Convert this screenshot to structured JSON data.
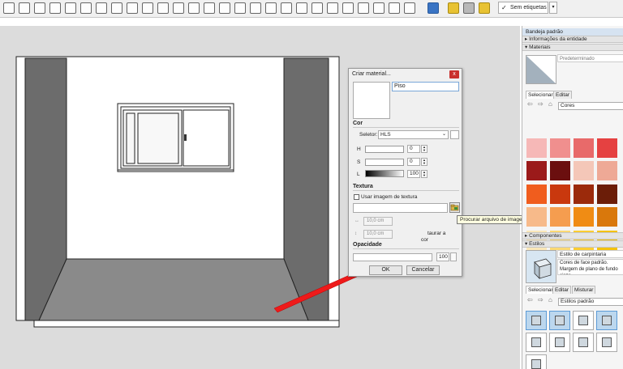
{
  "toolbar": {
    "tag_checkmark": "✓",
    "tag_label": "Sem etiquetas",
    "tag_dropdown_glyph": "▾"
  },
  "dialog": {
    "title": "Criar material...",
    "close_glyph": "x",
    "material_name": "Piso",
    "color_section": "Cor",
    "selector_label": "Seletor:",
    "selector_value": "HLS",
    "channels": [
      {
        "label": "H",
        "value": "0"
      },
      {
        "label": "S",
        "value": "0"
      },
      {
        "label": "L",
        "value": "100"
      }
    ],
    "texture_section": "Textura",
    "use_texture_label": "Usar imagem de textura",
    "width_value": "10,0 cm",
    "height_value": "10,0 cm",
    "restore_text_1": "taurar a",
    "restore_text_2": "cor",
    "opacity_section": "Opacidade",
    "opacity_value": "100",
    "ok_label": "OK",
    "cancel_label": "Cancelar"
  },
  "tooltip": "Procurar arquivo de imagem de material",
  "tray": {
    "title": "Bandeja padrão",
    "entity_info": "Informações da entidade",
    "materials": "Materiais",
    "material_default": "Predeterminado",
    "tab_select": "Selecionar",
    "tab_edit": "Editar",
    "library": "Cores",
    "components": "Componentes",
    "styles": "Estilos",
    "style_name": "Estilo de carpintaria",
    "style_desc": "Cores de face padrão. Margem de plano de fundo cinza.",
    "styles_tab_select": "Selecionar",
    "styles_tab_edit": "Editar",
    "styles_tab_mix": "Misturar",
    "styles_library": "Estilos padrão"
  },
  "swatch_colors": [
    "#f6b8b7",
    "#f08f8e",
    "#e86a6a",
    "#e54141",
    "#9b1a1a",
    "#6b0f0f",
    "#f4c7b8",
    "#eea996",
    "#f05d1e",
    "#c9380e",
    "#9b2a0b",
    "#6b1d08",
    "#f7ba8a",
    "#f59d4f",
    "#f08c14",
    "#d9780c",
    "#fae7b8",
    "#fbd973",
    "#fbcd33",
    "#f4c20a"
  ]
}
